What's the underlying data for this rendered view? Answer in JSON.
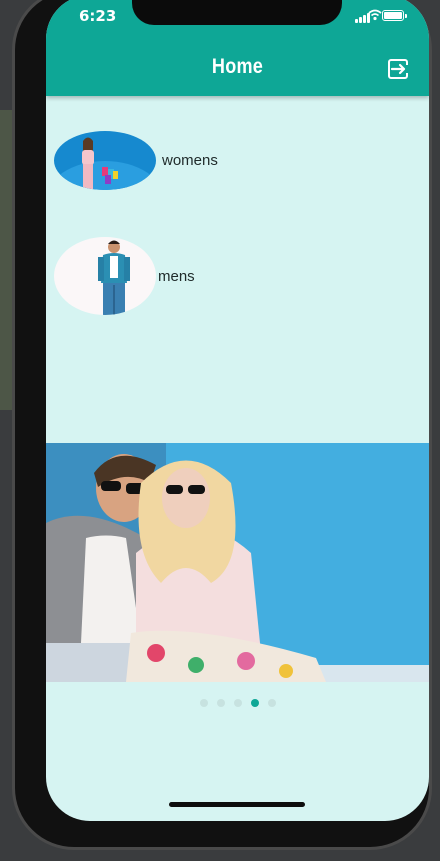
{
  "status_bar": {
    "time": "6:23"
  },
  "app_bar": {
    "title": "Home",
    "logout_icon": "logout-icon"
  },
  "categories": [
    {
      "label": "womens",
      "image": "woman-shopping-bags-photo"
    },
    {
      "label": "mens",
      "image": "man-denim-shirt-photo"
    }
  ],
  "banner": {
    "image": "couple-sunglasses-photo",
    "slide_count": 5,
    "active_slide": 4
  },
  "colors": {
    "primary": "#0ea796",
    "background": "#d6f4f2",
    "dot_inactive": "#c7e2e0"
  }
}
